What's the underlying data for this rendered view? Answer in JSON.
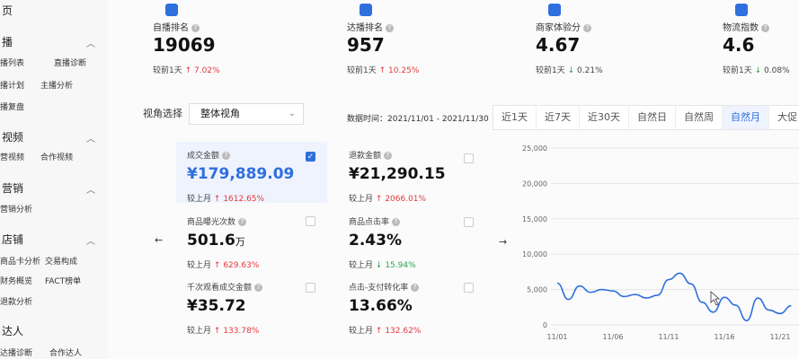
{
  "sidebar": {
    "top_partial": "页",
    "sections": [
      {
        "title": "播",
        "links": [
          "播列表",
          "直播诊断",
          "播计划",
          "主播分析",
          "播复盘"
        ]
      },
      {
        "title": "视频",
        "links": [
          "营视频",
          "合作视频"
        ]
      },
      {
        "title": "营销",
        "links": [
          "营销分析"
        ]
      },
      {
        "title": "店铺",
        "links": [
          "商品卡分析",
          "交易构成",
          "财务概览",
          "FACT榜单",
          "退款分析"
        ]
      },
      {
        "title": "达人",
        "links": [
          "达播诊断",
          "合作达人"
        ]
      }
    ]
  },
  "stats": [
    {
      "label": "自播排名",
      "value": "19069",
      "compare_label": "较前1天",
      "change": "7.02%",
      "direction": "up"
    },
    {
      "label": "达播排名",
      "value": "957",
      "compare_label": "较前1天",
      "change": "10.25%",
      "direction": "up"
    },
    {
      "label": "商家体验分",
      "value": "4.67",
      "compare_label": "较前1天",
      "change": "0.21%",
      "direction": "down"
    },
    {
      "label": "物流指数",
      "value": "4.6",
      "compare_label": "较前1天",
      "change": "0.08%",
      "direction": "down"
    }
  ],
  "view_select": {
    "label": "视角选择",
    "value": "整体视角"
  },
  "date": {
    "text": "数据时间：2021/11/01 - 2021/11/30"
  },
  "period_tabs": [
    "近1天",
    "近7天",
    "近30天",
    "自然日",
    "自然周",
    "自然月",
    "大促"
  ],
  "active_tab": "自然月",
  "metrics": [
    {
      "label": "成交金额",
      "value": "¥179,889.09",
      "compare_label": "较上月",
      "change": "1612.65%",
      "direction": "up",
      "checked": true
    },
    {
      "label": "退款金额",
      "value": "¥21,290.15",
      "compare_label": "较上月",
      "change": "2066.01%",
      "direction": "up",
      "checked": false
    },
    {
      "label": "商品曝光次数",
      "value": "501.6",
      "unit": "万",
      "compare_label": "较上月",
      "change": "629.63%",
      "direction": "up",
      "checked": false
    },
    {
      "label": "商品点击率",
      "value": "2.43%",
      "compare_label": "较上月",
      "change": "15.94%",
      "direction": "down",
      "checked": false
    },
    {
      "label": "千次观看成交金额",
      "value": "¥35.72",
      "compare_label": "较上月",
      "change": "133.78%",
      "direction": "up",
      "checked": false
    },
    {
      "label": "点击-支付转化率",
      "value": "13.66%",
      "compare_label": "较上月",
      "change": "132.62%",
      "direction": "up",
      "checked": false
    }
  ],
  "nav": {
    "prev": "←",
    "next": "→"
  },
  "icons": {
    "stat_icons": [
      "rank-icon",
      "person-icon",
      "badge-icon",
      "truck-icon"
    ],
    "help": "question-icon"
  },
  "colors": {
    "accent": "#2f6fde",
    "up": "#e4393c",
    "down": "#2da44e"
  },
  "chart_data": {
    "type": "line",
    "ylim": [
      0,
      25000
    ],
    "yticks": [
      "25,000",
      "20,000",
      "15,000",
      "10,000",
      "5,000",
      "0"
    ],
    "ytick_values": [
      25000,
      20000,
      15000,
      10000,
      5000,
      0
    ],
    "xticks": [
      "11/01",
      "11/06",
      "11/11",
      "11/16",
      "11/21"
    ],
    "x": [
      "11/01",
      "11/02",
      "11/03",
      "11/04",
      "11/05",
      "11/06",
      "11/07",
      "11/08",
      "11/09",
      "11/10",
      "11/11",
      "11/12",
      "11/13",
      "11/14",
      "11/15",
      "11/16",
      "11/17",
      "11/18",
      "11/19",
      "11/20",
      "11/21",
      "11/22"
    ],
    "series": [
      {
        "values": [
          5900,
          3600,
          5500,
          4600,
          5000,
          4800,
          4000,
          4300,
          3800,
          4200,
          6400,
          7300,
          5800,
          3200,
          1800,
          3900,
          2800,
          600,
          3800,
          2100,
          1600,
          2700
        ]
      }
    ]
  }
}
